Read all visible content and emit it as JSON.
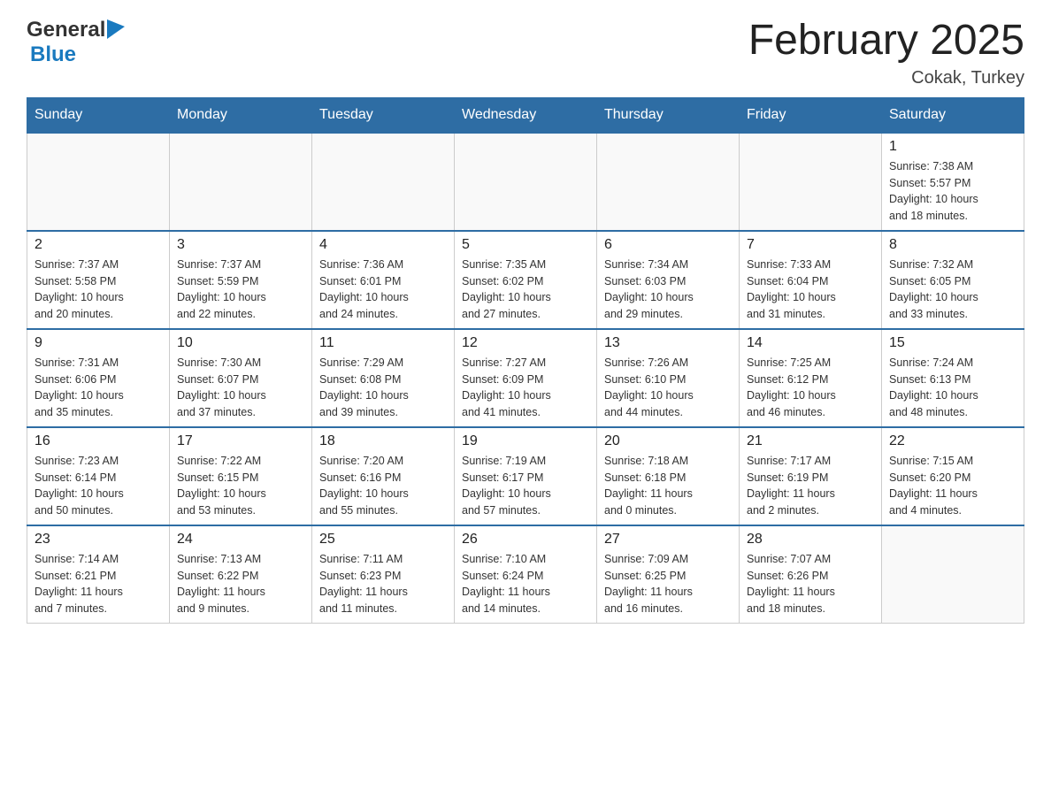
{
  "header": {
    "logo_general": "General",
    "logo_blue": "Blue",
    "month_title": "February 2025",
    "location": "Cokak, Turkey"
  },
  "weekdays": [
    "Sunday",
    "Monday",
    "Tuesday",
    "Wednesday",
    "Thursday",
    "Friday",
    "Saturday"
  ],
  "weeks": [
    [
      {
        "day": "",
        "info": ""
      },
      {
        "day": "",
        "info": ""
      },
      {
        "day": "",
        "info": ""
      },
      {
        "day": "",
        "info": ""
      },
      {
        "day": "",
        "info": ""
      },
      {
        "day": "",
        "info": ""
      },
      {
        "day": "1",
        "info": "Sunrise: 7:38 AM\nSunset: 5:57 PM\nDaylight: 10 hours\nand 18 minutes."
      }
    ],
    [
      {
        "day": "2",
        "info": "Sunrise: 7:37 AM\nSunset: 5:58 PM\nDaylight: 10 hours\nand 20 minutes."
      },
      {
        "day": "3",
        "info": "Sunrise: 7:37 AM\nSunset: 5:59 PM\nDaylight: 10 hours\nand 22 minutes."
      },
      {
        "day": "4",
        "info": "Sunrise: 7:36 AM\nSunset: 6:01 PM\nDaylight: 10 hours\nand 24 minutes."
      },
      {
        "day": "5",
        "info": "Sunrise: 7:35 AM\nSunset: 6:02 PM\nDaylight: 10 hours\nand 27 minutes."
      },
      {
        "day": "6",
        "info": "Sunrise: 7:34 AM\nSunset: 6:03 PM\nDaylight: 10 hours\nand 29 minutes."
      },
      {
        "day": "7",
        "info": "Sunrise: 7:33 AM\nSunset: 6:04 PM\nDaylight: 10 hours\nand 31 minutes."
      },
      {
        "day": "8",
        "info": "Sunrise: 7:32 AM\nSunset: 6:05 PM\nDaylight: 10 hours\nand 33 minutes."
      }
    ],
    [
      {
        "day": "9",
        "info": "Sunrise: 7:31 AM\nSunset: 6:06 PM\nDaylight: 10 hours\nand 35 minutes."
      },
      {
        "day": "10",
        "info": "Sunrise: 7:30 AM\nSunset: 6:07 PM\nDaylight: 10 hours\nand 37 minutes."
      },
      {
        "day": "11",
        "info": "Sunrise: 7:29 AM\nSunset: 6:08 PM\nDaylight: 10 hours\nand 39 minutes."
      },
      {
        "day": "12",
        "info": "Sunrise: 7:27 AM\nSunset: 6:09 PM\nDaylight: 10 hours\nand 41 minutes."
      },
      {
        "day": "13",
        "info": "Sunrise: 7:26 AM\nSunset: 6:10 PM\nDaylight: 10 hours\nand 44 minutes."
      },
      {
        "day": "14",
        "info": "Sunrise: 7:25 AM\nSunset: 6:12 PM\nDaylight: 10 hours\nand 46 minutes."
      },
      {
        "day": "15",
        "info": "Sunrise: 7:24 AM\nSunset: 6:13 PM\nDaylight: 10 hours\nand 48 minutes."
      }
    ],
    [
      {
        "day": "16",
        "info": "Sunrise: 7:23 AM\nSunset: 6:14 PM\nDaylight: 10 hours\nand 50 minutes."
      },
      {
        "day": "17",
        "info": "Sunrise: 7:22 AM\nSunset: 6:15 PM\nDaylight: 10 hours\nand 53 minutes."
      },
      {
        "day": "18",
        "info": "Sunrise: 7:20 AM\nSunset: 6:16 PM\nDaylight: 10 hours\nand 55 minutes."
      },
      {
        "day": "19",
        "info": "Sunrise: 7:19 AM\nSunset: 6:17 PM\nDaylight: 10 hours\nand 57 minutes."
      },
      {
        "day": "20",
        "info": "Sunrise: 7:18 AM\nSunset: 6:18 PM\nDaylight: 11 hours\nand 0 minutes."
      },
      {
        "day": "21",
        "info": "Sunrise: 7:17 AM\nSunset: 6:19 PM\nDaylight: 11 hours\nand 2 minutes."
      },
      {
        "day": "22",
        "info": "Sunrise: 7:15 AM\nSunset: 6:20 PM\nDaylight: 11 hours\nand 4 minutes."
      }
    ],
    [
      {
        "day": "23",
        "info": "Sunrise: 7:14 AM\nSunset: 6:21 PM\nDaylight: 11 hours\nand 7 minutes."
      },
      {
        "day": "24",
        "info": "Sunrise: 7:13 AM\nSunset: 6:22 PM\nDaylight: 11 hours\nand 9 minutes."
      },
      {
        "day": "25",
        "info": "Sunrise: 7:11 AM\nSunset: 6:23 PM\nDaylight: 11 hours\nand 11 minutes."
      },
      {
        "day": "26",
        "info": "Sunrise: 7:10 AM\nSunset: 6:24 PM\nDaylight: 11 hours\nand 14 minutes."
      },
      {
        "day": "27",
        "info": "Sunrise: 7:09 AM\nSunset: 6:25 PM\nDaylight: 11 hours\nand 16 minutes."
      },
      {
        "day": "28",
        "info": "Sunrise: 7:07 AM\nSunset: 6:26 PM\nDaylight: 11 hours\nand 18 minutes."
      },
      {
        "day": "",
        "info": ""
      }
    ]
  ]
}
